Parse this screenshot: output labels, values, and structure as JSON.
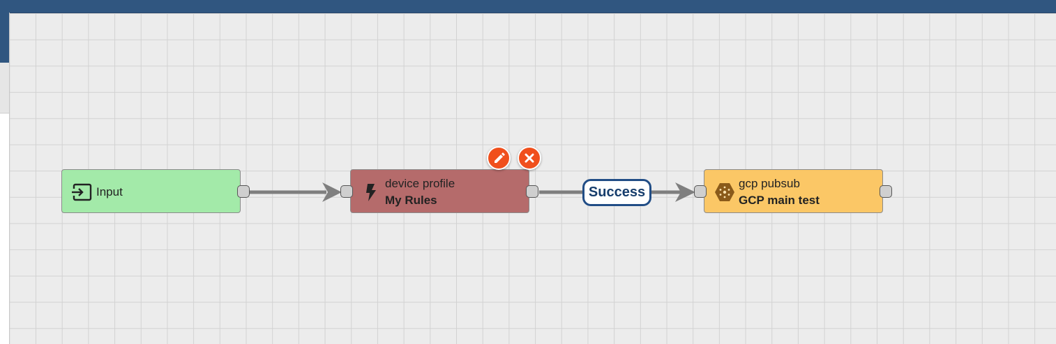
{
  "app": {
    "accent_color": "#305680",
    "canvas_background": "#ececec"
  },
  "nodes": [
    {
      "id": "input",
      "type_label": "Input",
      "icon": "input-icon",
      "color": "#a3eaa9"
    },
    {
      "id": "device-profile",
      "type_label": "device profile",
      "name": "My Rules",
      "icon": "bolt-icon",
      "color": "#b56b6b"
    },
    {
      "id": "gcp-pubsub",
      "type_label": "gcp pubsub",
      "name": "GCP main test",
      "icon": "gcp-pubsub-icon",
      "color": "#fbc766"
    }
  ],
  "edges": [
    {
      "from": "input",
      "to": "device-profile",
      "label": ""
    },
    {
      "from": "device-profile",
      "to": "gcp-pubsub",
      "label": "Success"
    }
  ],
  "node_actions": {
    "edit_icon": "pencil-icon",
    "delete_icon": "close-icon",
    "color": "#f04f1c"
  }
}
